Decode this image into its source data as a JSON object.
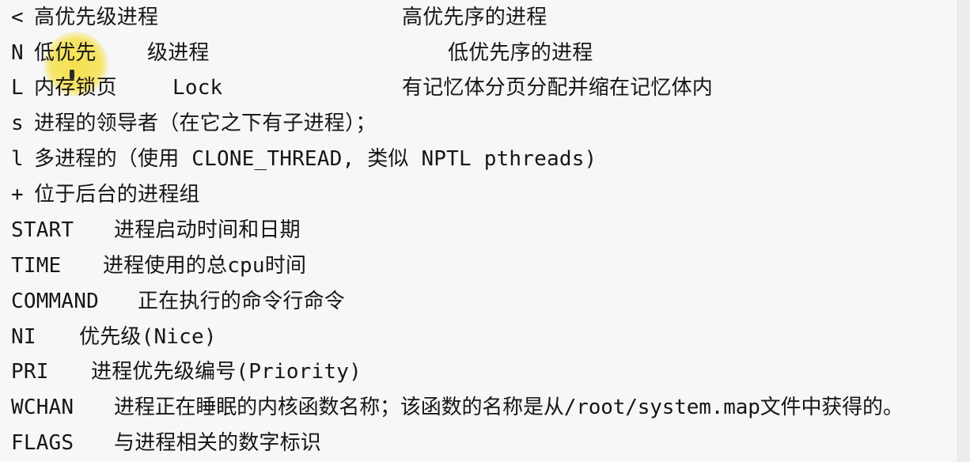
{
  "lines": [
    {
      "key": "<",
      "desc": "高优先级进程",
      "note": "高优先序的进程"
    },
    {
      "key": "N",
      "desc": "低优先",
      "desc2": "级进程",
      "note": "低优先序的进程"
    },
    {
      "key": "L",
      "desc": "内存锁页",
      "desc2": "Lock",
      "note": "有记忆体分页分配并缩在记忆体内"
    },
    {
      "key": "s",
      "desc": "进程的领导者（在它之下有子进程）；"
    },
    {
      "key": "l",
      "desc": "多进程的（使用 CLONE_THREAD, 类似 NPTL pthreads)"
    },
    {
      "key": "+",
      "desc": "位于后台的进程组"
    },
    {
      "key": "START",
      "desc": "进程启动时间和日期"
    },
    {
      "key": "TIME",
      "desc": "进程使用的总cpu时间"
    },
    {
      "key": "COMMAND",
      "desc": "正在执行的命令行命令"
    },
    {
      "key": "NI",
      "desc": "优先级(Nice)"
    },
    {
      "key": "PRI",
      "desc": "进程优先级编号(Priority)"
    },
    {
      "key": "WCHAN",
      "desc": "进程正在睡眠的内核函数名称；该函数的名称是从/root/system.map文件中获得的。"
    },
    {
      "key": "FLAGS",
      "desc": "与进程相关的数字标识"
    }
  ],
  "colors": {
    "background": "#f7f7f7",
    "text": "#161616",
    "highlight": "#f4dc28"
  }
}
